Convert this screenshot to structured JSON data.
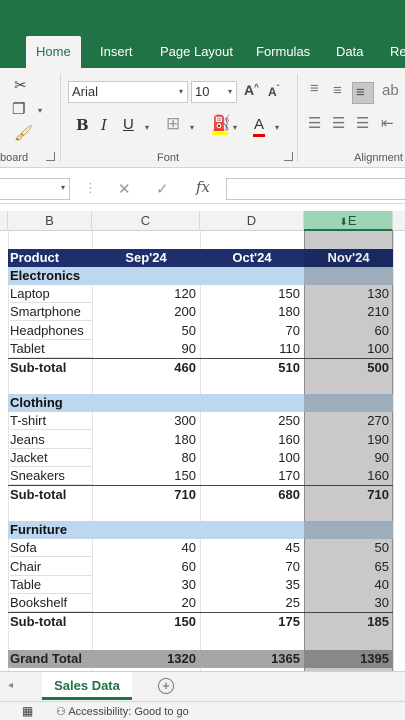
{
  "ribbon_tabs": [
    "Home",
    "Insert",
    "Page Layout",
    "Formulas",
    "Data",
    "Re"
  ],
  "clipboard": {
    "group_label": "board"
  },
  "font": {
    "name": "Arial",
    "size": "10",
    "group_label": "Font",
    "bold": "B",
    "italic": "I",
    "underline": "U",
    "grow": "A",
    "shrink": "A",
    "font_color": "A"
  },
  "alignment": {
    "group_label": "Alignment"
  },
  "formula_bar": {
    "fx": "fx",
    "cancel": "✕",
    "enter": "✓"
  },
  "columns": [
    "B",
    "C",
    "D",
    "E"
  ],
  "table": {
    "header": [
      "Product",
      "Sep'24",
      "Oct'24",
      "Nov'24"
    ],
    "rows": [
      {
        "type": "category",
        "cells": [
          "Electronics",
          "",
          "",
          ""
        ]
      },
      {
        "type": "data",
        "cells": [
          "Laptop",
          "120",
          "150",
          "130"
        ]
      },
      {
        "type": "data",
        "cells": [
          "Smartphone",
          "200",
          "180",
          "210"
        ]
      },
      {
        "type": "data",
        "cells": [
          "Headphones",
          "50",
          "70",
          "60"
        ]
      },
      {
        "type": "data",
        "cells": [
          "Tablet",
          "90",
          "110",
          "100"
        ]
      },
      {
        "type": "subtotal",
        "cells": [
          "Sub-total",
          "460",
          "510",
          "500"
        ]
      },
      {
        "type": "blank",
        "cells": [
          "",
          "",
          "",
          ""
        ]
      },
      {
        "type": "category",
        "cells": [
          "Clothing",
          "",
          "",
          ""
        ]
      },
      {
        "type": "data",
        "cells": [
          "T-shirt",
          "300",
          "250",
          "270"
        ]
      },
      {
        "type": "data",
        "cells": [
          "Jeans",
          "180",
          "160",
          "190"
        ]
      },
      {
        "type": "data",
        "cells": [
          "Jacket",
          "80",
          "100",
          "90"
        ]
      },
      {
        "type": "data",
        "cells": [
          "Sneakers",
          "150",
          "170",
          "160"
        ]
      },
      {
        "type": "subtotal",
        "cells": [
          "Sub-total",
          "710",
          "680",
          "710"
        ]
      },
      {
        "type": "blank",
        "cells": [
          "",
          "",
          "",
          ""
        ]
      },
      {
        "type": "category",
        "cells": [
          "Furniture",
          "",
          "",
          ""
        ]
      },
      {
        "type": "data",
        "cells": [
          "Sofa",
          "40",
          "45",
          "50"
        ]
      },
      {
        "type": "data",
        "cells": [
          "Chair",
          "60",
          "70",
          "65"
        ]
      },
      {
        "type": "data",
        "cells": [
          "Table",
          "30",
          "35",
          "40"
        ]
      },
      {
        "type": "data",
        "cells": [
          "Bookshelf",
          "20",
          "25",
          "30"
        ]
      },
      {
        "type": "subtotal",
        "cells": [
          "Sub-total",
          "150",
          "175",
          "185"
        ]
      },
      {
        "type": "blank",
        "cells": [
          "",
          "",
          "",
          ""
        ]
      },
      {
        "type": "grand",
        "cells": [
          "Grand Total",
          "1320",
          "1365",
          "1395"
        ]
      }
    ]
  },
  "sheets": {
    "active": "Sales Data",
    "add": "+"
  },
  "status": {
    "accessibility": "Accessibility: Good to go"
  },
  "colors": {
    "brand_green": "#217346",
    "header_navy": "#1f2f6e",
    "category_blue": "#bdd7ee",
    "selection_gray": "#c9c9c9"
  }
}
